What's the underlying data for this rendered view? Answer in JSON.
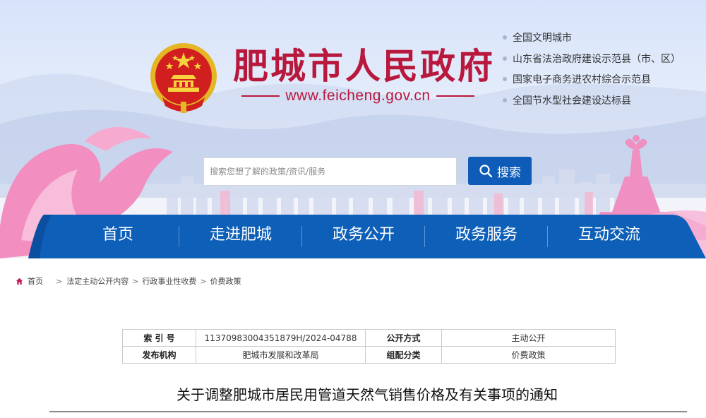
{
  "site": {
    "title": "肥城市人民政府",
    "url": "www.feicheng.gov.cn"
  },
  "honors": [
    "全国文明城市",
    "山东省法治政府建设示范县（市、区）",
    "国家电子商务进农村综合示范县",
    "全国节水型社会建设达标县"
  ],
  "search": {
    "placeholder": "搜索您想了解的政策/资讯/服务",
    "button_label": "搜索"
  },
  "nav": [
    {
      "label": "首页"
    },
    {
      "label": "走进肥城"
    },
    {
      "label": "政务公开"
    },
    {
      "label": "政务服务"
    },
    {
      "label": "互动交流"
    }
  ],
  "breadcrumb": {
    "home": "首页",
    "items": [
      "法定主动公开内容",
      "行政事业性收费",
      "价费政策"
    ],
    "separator": ">"
  },
  "info": {
    "index_label": "索 引 号",
    "index_value": "11370983004351879H/2024-04788",
    "mode_label": "公开方式",
    "mode_value": "主动公开",
    "publisher_label": "发布机构",
    "publisher_value": "肥城市发展和改革局",
    "category_label": "组配分类",
    "category_value": "价费政策"
  },
  "article": {
    "title": "关于调整肥城市居民用管道天然气销售价格及有关事项的通知"
  },
  "colors": {
    "brand_red": "#b8183c",
    "nav_blue": "#0d5fb8",
    "search_blue": "#0e5bb8",
    "accent_pink": "#f08ec0"
  },
  "icons": {
    "emblem": "national-emblem",
    "search": "magnifier-icon",
    "home": "home-icon"
  }
}
